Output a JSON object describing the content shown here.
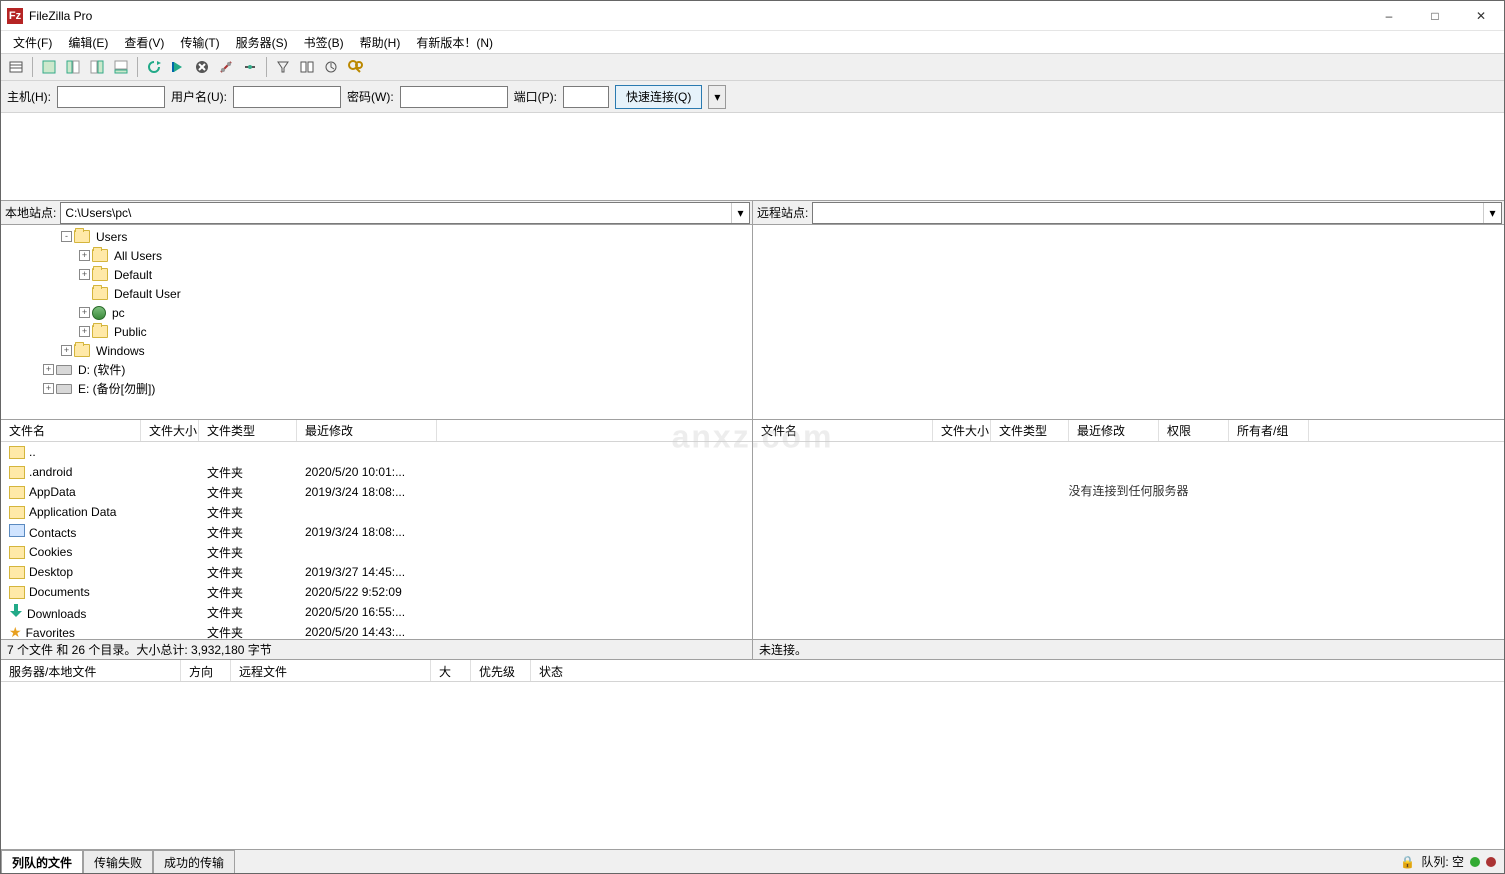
{
  "title": "FileZilla Pro",
  "menu": [
    "文件(F)",
    "编辑(E)",
    "查看(V)",
    "传输(T)",
    "服务器(S)",
    "书签(B)",
    "帮助(H)",
    "有新版本！(N)"
  ],
  "quickconnect": {
    "host_label": "主机(H):",
    "user_label": "用户名(U):",
    "pass_label": "密码(W):",
    "port_label": "端口(P):",
    "button": "快速连接(Q)"
  },
  "local_site_label": "本地站点:",
  "local_site_path": "C:\\Users\\pc\\",
  "remote_site_label": "远程站点:",
  "tree": [
    {
      "indent": 3,
      "exp": "-",
      "icon": "folder",
      "label": "Users"
    },
    {
      "indent": 4,
      "exp": "+",
      "icon": "folder",
      "label": "All Users"
    },
    {
      "indent": 4,
      "exp": "+",
      "icon": "folder",
      "label": "Default"
    },
    {
      "indent": 4,
      "exp": " ",
      "icon": "folder",
      "label": "Default User"
    },
    {
      "indent": 4,
      "exp": "+",
      "icon": "user",
      "label": "pc"
    },
    {
      "indent": 4,
      "exp": "+",
      "icon": "folder",
      "label": "Public"
    },
    {
      "indent": 3,
      "exp": "+",
      "icon": "folder",
      "label": "Windows"
    },
    {
      "indent": 2,
      "exp": "+",
      "icon": "drive",
      "label": "D: (软件)"
    },
    {
      "indent": 2,
      "exp": "+",
      "icon": "drive",
      "label": "E: (备份[勿删])"
    }
  ],
  "local_columns": {
    "name": "文件名",
    "size": "文件大小",
    "type": "文件类型",
    "modified": "最近修改"
  },
  "remote_columns": {
    "name": "文件名",
    "size": "文件大小",
    "type": "文件类型",
    "modified": "最近修改",
    "perm": "权限",
    "owner": "所有者/组"
  },
  "local_files": [
    {
      "icon": "up",
      "name": ".."
    },
    {
      "icon": "folder",
      "name": ".android",
      "type": "文件夹",
      "modified": "2020/5/20 10:01:..."
    },
    {
      "icon": "folder",
      "name": "AppData",
      "type": "文件夹",
      "modified": "2019/3/24 18:08:..."
    },
    {
      "icon": "folder",
      "name": "Application Data",
      "type": "文件夹"
    },
    {
      "icon": "contacts",
      "name": "Contacts",
      "type": "文件夹",
      "modified": "2019/3/24 18:08:..."
    },
    {
      "icon": "folder",
      "name": "Cookies",
      "type": "文件夹"
    },
    {
      "icon": "folder",
      "name": "Desktop",
      "type": "文件夹",
      "modified": "2019/3/27 14:45:..."
    },
    {
      "icon": "folder",
      "name": "Documents",
      "type": "文件夹",
      "modified": "2020/5/22 9:52:09"
    },
    {
      "icon": "downloads",
      "name": "Downloads",
      "type": "文件夹",
      "modified": "2020/5/20 16:55:..."
    },
    {
      "icon": "star",
      "name": "Favorites",
      "type": "文件夹",
      "modified": "2020/5/20 14:43:..."
    }
  ],
  "local_status": "7 个文件 和 26 个目录。大小总计: 3,932,180 字节",
  "remote_empty": "没有连接到任何服务器",
  "remote_status": "未连接。",
  "queue_columns": {
    "server": "服务器/本地文件",
    "dir": "方向",
    "remote": "远程文件",
    "size": "大小",
    "prio": "优先级",
    "status": "状态"
  },
  "queue_tabs": [
    "列队的文件",
    "传输失败",
    "成功的传输"
  ],
  "queue_label": "队列: 空",
  "watermark": "anxz.com"
}
